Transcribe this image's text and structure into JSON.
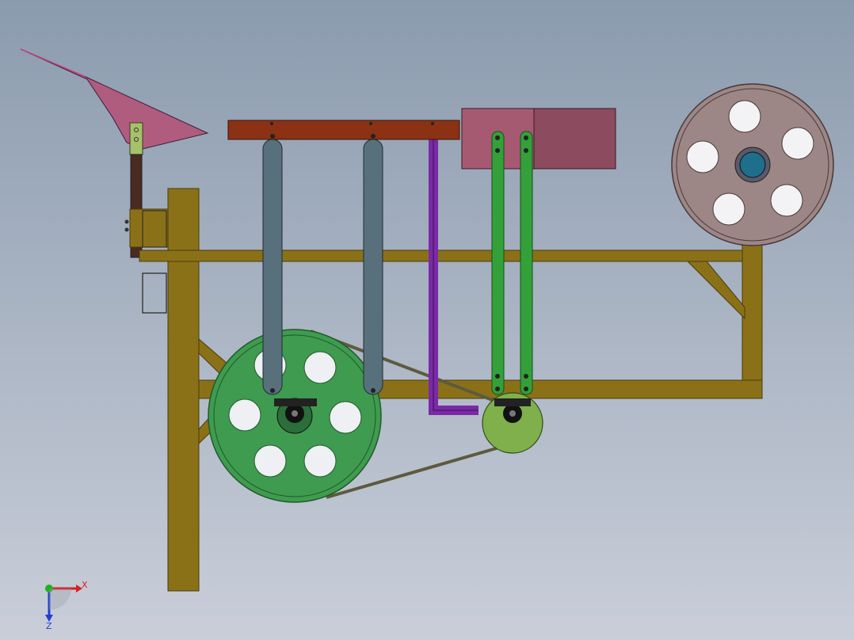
{
  "colors": {
    "bg_top": "#8b9bae",
    "bg_bottom": "#c9ced9",
    "frame": "#8a7118",
    "frame_edge": "#4a3c0a",
    "blade": "#b05c7e",
    "bracket": "#a7c06a",
    "bar": "#8b3214",
    "rod": "#57707c",
    "purple": "#7a2aa6",
    "green_link": "#34a039",
    "box": "#a65a71",
    "big_wheel": "#9c8686",
    "green_wheel": "#3f9b4f",
    "small_wheel": "#7fb04c",
    "hub": "#1e6e8c",
    "belt": "#5d5a3e",
    "triad_x": "#d42020",
    "triad_y": "#20b020",
    "triad_z": "#2040d0"
  },
  "triad": {
    "x_label": "X",
    "z_label": "Z"
  }
}
